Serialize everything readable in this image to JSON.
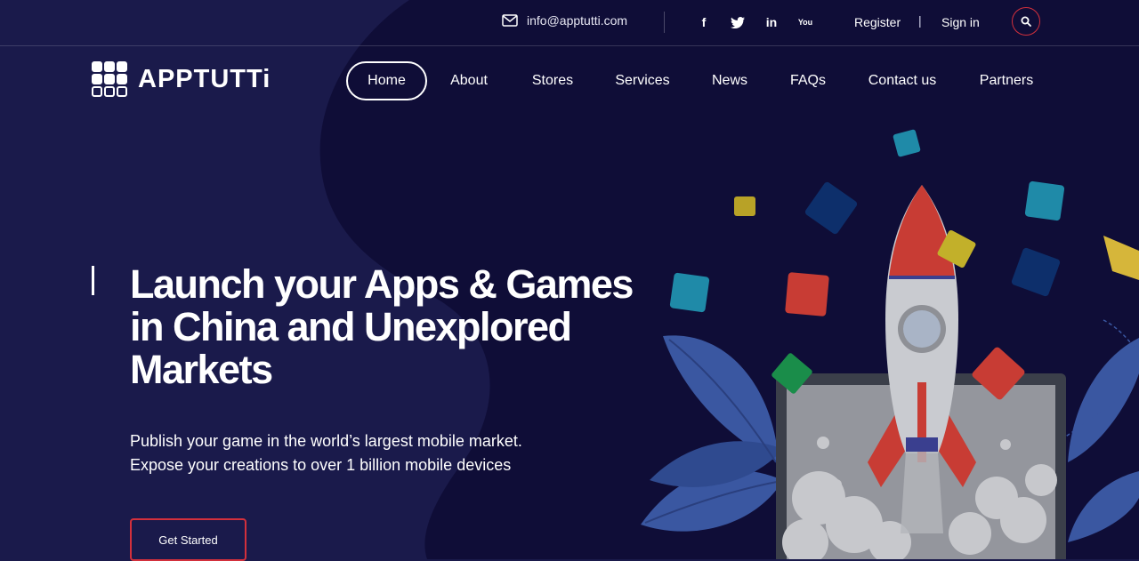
{
  "topbar": {
    "email": "info@apptutti.com",
    "social": [
      {
        "icon": "facebook-icon",
        "glyph": "f"
      },
      {
        "icon": "twitter-icon",
        "glyph": "t"
      },
      {
        "icon": "linkedin-icon",
        "glyph": "in"
      },
      {
        "icon": "youtube-icon",
        "glyph": "You"
      }
    ],
    "register": "Register",
    "separator": "|",
    "signin": "Sign in"
  },
  "brand": {
    "name": "APPTUTTi"
  },
  "nav": {
    "active": "Home",
    "items": [
      "Home",
      "About",
      "Stores",
      "Services",
      "News",
      "FAQs",
      "Contact us",
      "Partners"
    ]
  },
  "hero": {
    "title": "Launch your Apps & Games in China and Unexplored Markets",
    "subtitle_line1": "Publish your game in the world’s largest mobile market.",
    "subtitle_line2": "Expose your creations to over 1 billion mobile devices",
    "cta": "Get Started"
  },
  "colors": {
    "background": "#1a1a4b",
    "blob": "#0f0d37",
    "accent": "#d3303c",
    "rocket_red": "#c83c34",
    "leaf_blue": "#3a57a1"
  }
}
